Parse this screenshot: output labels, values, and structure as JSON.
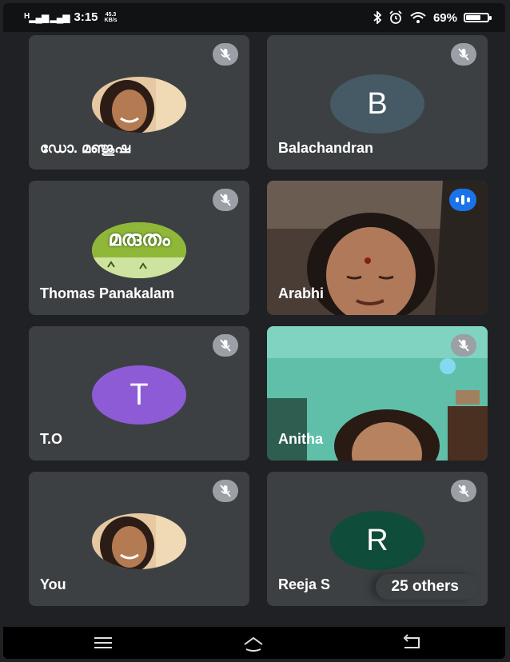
{
  "status_bar": {
    "network": "H",
    "time": "3:15",
    "speed_value": "45.3",
    "speed_unit": "KB/s",
    "battery_percent": "69%",
    "battery_level": 0.69,
    "icons": [
      "signal-icon",
      "bluetooth-icon",
      "alarm-icon",
      "wifi-icon",
      "battery-icon"
    ]
  },
  "tiles": [
    {
      "name": "ഡോ. മഞ്ജുഷ",
      "avatar": "photo",
      "muted": true
    },
    {
      "name": "Balachandran",
      "avatar": "letter",
      "initial": "B",
      "color": "#455a64",
      "muted": true
    },
    {
      "name": "Thomas Panakalam",
      "avatar": "logo",
      "logo_text": "മരുതം",
      "muted": true
    },
    {
      "name": "Arabhi",
      "avatar": "video",
      "muted": false,
      "speaking": true
    },
    {
      "name": "T.O",
      "avatar": "letter",
      "initial": "T",
      "color": "#8e5bd6",
      "muted": true
    },
    {
      "name": "Anitha",
      "avatar": "video",
      "muted": true
    },
    {
      "name": "You",
      "avatar": "photo",
      "muted": true
    },
    {
      "name": "Reeja S",
      "avatar": "letter",
      "initial": "R",
      "color": "#0f4c3a",
      "muted": true
    }
  ],
  "others": {
    "label": "25 others"
  },
  "nav": [
    "menu-icon",
    "home-icon",
    "back-icon"
  ]
}
